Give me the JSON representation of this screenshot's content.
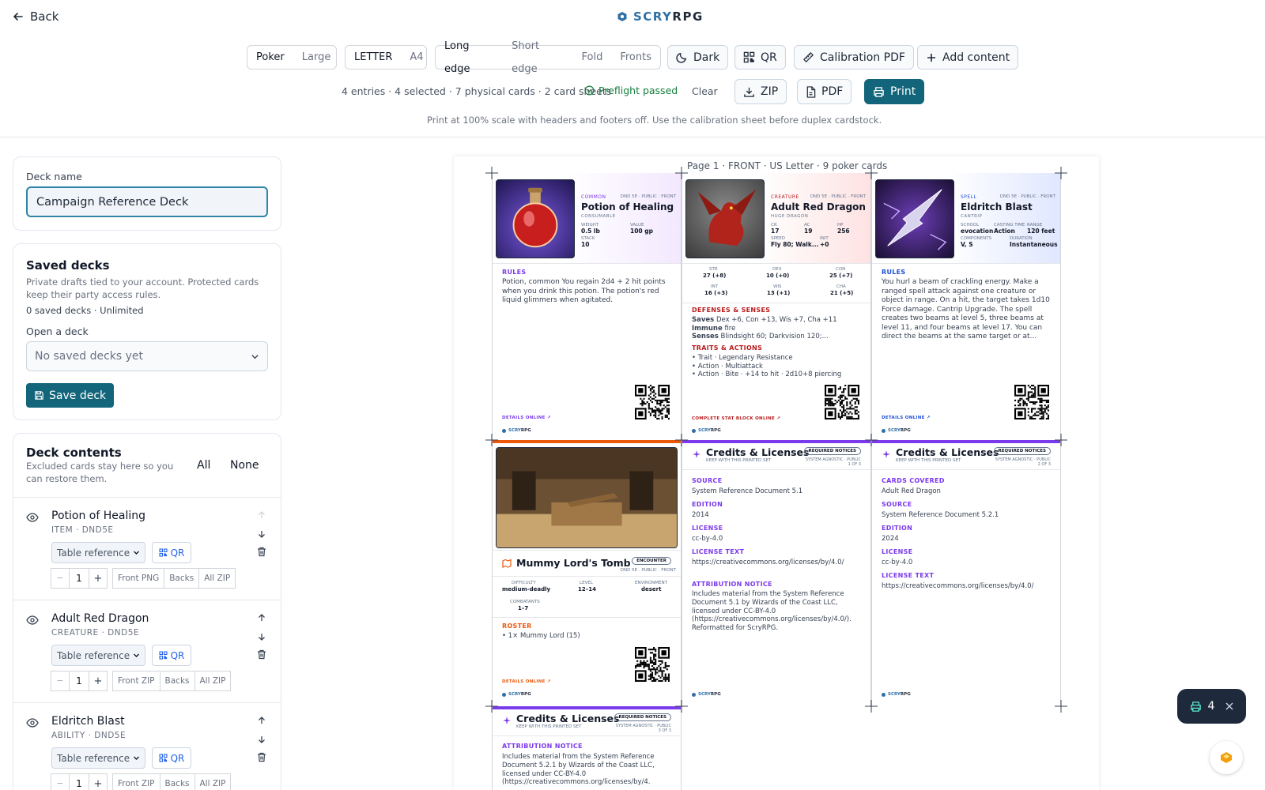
{
  "header": {
    "back_label": "Back",
    "brand_a": "SCRY",
    "brand_b": "RPG"
  },
  "toolbar": {
    "size_options": [
      "Poker",
      "Large"
    ],
    "paper_options": [
      "LETTER",
      "A4"
    ],
    "duplex_options": [
      "Long edge",
      "Short edge",
      "Fold",
      "Fronts"
    ],
    "dark_label": "Dark",
    "qr_label": "QR",
    "calibration_label": "Calibration PDF",
    "add_content_label": "Add content",
    "summary": "4 entries · 4 selected · 7 physical cards · 2 card sheets",
    "preflight": "Preflight passed",
    "clear_label": "Clear",
    "zip_label": "ZIP",
    "pdf_label": "PDF",
    "print_label": "Print",
    "hint": "Print at 100% scale with headers and footers off. Use the calibration sheet before duplex cardstock."
  },
  "deck": {
    "name_label": "Deck name",
    "name_value": "Campaign Reference Deck"
  },
  "saved": {
    "title": "Saved decks",
    "desc": "Private drafts tied to your account. Protected cards keep their party access rules.",
    "count": "0 saved decks · Unlimited",
    "open_label": "Open a deck",
    "select_value": "No saved decks yet",
    "save_label": "Save deck"
  },
  "contents": {
    "title": "Deck contents",
    "desc": "Excluded cards stay here so you can restore them.",
    "all_label": "All",
    "none_label": "None",
    "items": [
      {
        "name": "Potion of Healing",
        "sub": "ITEM · DND5E",
        "mode": "Table reference",
        "qr": "QR",
        "qty": "1",
        "b1": "Front PNG",
        "b2": "Backs",
        "b3": "All ZIP"
      },
      {
        "name": "Adult Red Dragon",
        "sub": "CREATURE · DND5E",
        "mode": "Table reference",
        "qr": "QR",
        "qty": "1",
        "b1": "Front ZIP",
        "b2": "Backs",
        "b3": "All ZIP"
      },
      {
        "name": "Eldritch Blast",
        "sub": "ABILITY · DND5E",
        "mode": "Table reference",
        "qr": "QR",
        "qty": "1",
        "b1": "Front ZIP",
        "b2": "Backs",
        "b3": "All ZIP"
      }
    ]
  },
  "page": {
    "label": "Page 1 · FRONT · US Letter · 9 poker cards"
  },
  "cards": {
    "potion": {
      "tag": "COMMON",
      "pub": "DND 5E · PUBLIC · FRONT",
      "name": "Potion of Healing",
      "sub": "CONSUMABLE",
      "s1l": "WEIGHT",
      "s1v": "0.5 lb",
      "s2l": "VALUE",
      "s2v": "100 gp",
      "s3l": "STACK",
      "s3v": "10",
      "sect": "RULES",
      "text": "Potion, common You regain 2d4 + 2 hit points when you drink this potion. The potion's red liquid glimmers when agitated.",
      "foot": "DETAILS ONLINE ↗"
    },
    "dragon": {
      "tag": "CREATURE",
      "pub": "DND 5E · PUBLIC · FRONT",
      "name": "Adult Red Dragon",
      "sub": "HUGE DRAGON",
      "cr_l": "CR",
      "cr_v": "17",
      "ac_l": "AC",
      "ac_v": "19",
      "hp_l": "HP",
      "hp_v": "256",
      "speed_l": "SPEED",
      "speed_v": "Fly 80; Walk...",
      "init_l": "INIT",
      "init_v": "+0",
      "str_l": "STR",
      "str_v": "27 (+8)",
      "dex_l": "DEX",
      "dex_v": "10 (+0)",
      "con_l": "CON",
      "con_v": "25 (+7)",
      "int_l": "INT",
      "int_v": "16 (+3)",
      "wis_l": "WIS",
      "wis_v": "13 (+1)",
      "cha_l": "CHA",
      "cha_v": "21 (+5)",
      "def_title": "DEFENSES & SENSES",
      "saves_l": "Saves",
      "saves_v": "Dex +6, Con +13, Wis +7, Cha +11",
      "immune_l": "Immune",
      "immune_v": "fire",
      "senses_l": "Senses",
      "senses_v": "Blindsight 60; Darkvision 120;...",
      "traits_title": "TRAITS & ACTIONS",
      "traits": [
        "• Trait · Legendary Resistance",
        "• Action · Multiattack",
        "• Action · Bite · +14 to hit · 2d10+8 piercing"
      ],
      "foot": "COMPLETE STAT BLOCK ONLINE ↗"
    },
    "blast": {
      "tag": "SPELL",
      "pub": "DND 5E · PUBLIC · FRONT",
      "name": "Eldritch Blast",
      "sub": "CANTRIP",
      "s1l": "SCHOOL",
      "s1v": "evocation",
      "s2l": "CASTING TIME",
      "s2v": "Action",
      "s3l": "RANGE",
      "s3v": "120 feet",
      "s4l": "COMPONENTS",
      "s4v": "V, S",
      "s5l": "DURATION",
      "s5v": "Instantaneous",
      "sect": "RULES",
      "text": "You hurl a beam of crackling energy. Make a ranged spell attack against one creature or object in range. On a hit, the target takes 1d10 Force damage. Cantrip Upgrade. The spell creates two beams at level 5, three beams at level 11, and four beams at level 17. You can direct the beams at the same target or at...",
      "foot": "DETAILS ONLINE ↗"
    },
    "tomb": {
      "name": "Mummy Lord's Tomb",
      "badge": "ENCOUNTER",
      "pub": "DND 5E · PUBLIC · FRONT",
      "e1l": "DIFFICULTY",
      "e1v": "medium-deadly",
      "e2l": "LEVEL",
      "e2v": "12–14",
      "e3l": "ENVIRONMENT",
      "e3v": "desert",
      "e4l": "COMBATANTS",
      "e4v": "1–7",
      "sect": "ROSTER",
      "roster": "• 1× Mummy Lord (15)",
      "foot": "DETAILS ONLINE ↗"
    },
    "cred1": {
      "name": "Credits & Licenses",
      "sub": "KEEP WITH THIS PRINTED SET",
      "badge": "REQUIRED NOTICES",
      "meta": "SYSTEM AGNOSTIC · PUBLIC",
      "page": "1 OF 3",
      "source_l": "SOURCE",
      "source_v": "System Reference Document 5.1",
      "edition_l": "EDITION",
      "edition_v": "2014",
      "license_l": "LICENSE",
      "license_v": "cc-by-4.0",
      "ltext_l": "LICENSE TEXT",
      "ltext_v": "https://creativecommons.org/licenses/by/4.0/",
      "attr_l": "ATTRIBUTION NOTICE",
      "attr_v": "Includes material from the System Reference Document 5.1 by Wizards of the Coast LLC, licensed under CC-BY-4.0 (https://creativecommons.org/licenses/by/4.0/). Reformatted for ScryRPG."
    },
    "cred2": {
      "name": "Credits & Licenses",
      "sub": "KEEP WITH THIS PRINTED SET",
      "badge": "REQUIRED NOTICES",
      "meta": "SYSTEM AGNOSTIC · PUBLIC",
      "page": "2 OF 3",
      "covered_l": "CARDS COVERED",
      "covered_v": "Adult Red Dragon",
      "source_l": "SOURCE",
      "source_v": "System Reference Document 5.2.1",
      "edition_l": "EDITION",
      "edition_v": "2024",
      "license_l": "LICENSE",
      "license_v": "cc-by-4.0",
      "ltext_l": "LICENSE TEXT",
      "ltext_v": "https://creativecommons.org/licenses/by/4.0/"
    },
    "cred3": {
      "name": "Credits & Licenses",
      "sub": "KEEP WITH THIS PRINTED SET",
      "badge": "REQUIRED NOTICES",
      "meta": "SYSTEM AGNOSTIC · PUBLIC",
      "page": "3 OF 3",
      "attr_l": "ATTRIBUTION NOTICE",
      "attr_v": "Includes material from the System Reference Document 5.2.1 by Wizards of the Coast LLC, licensed under CC-BY-4.0 (https://creativecommons.org/licenses/by/4."
    }
  },
  "float": {
    "count": "4"
  },
  "colors": {
    "accent": "#12657a",
    "purple": "#7c3aed",
    "red": "#b91c1c",
    "blue": "#1d4ed8",
    "orange": "#ea580c"
  }
}
